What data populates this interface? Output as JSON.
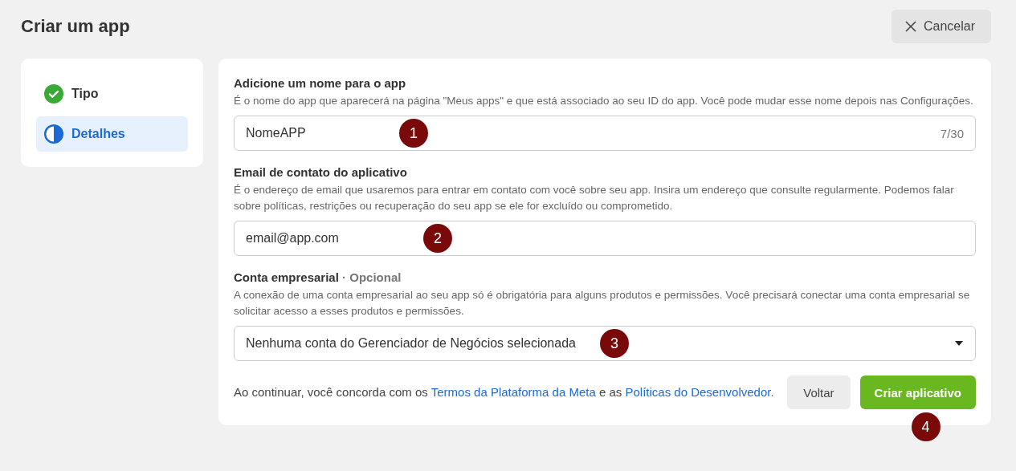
{
  "header": {
    "title": "Criar um app",
    "cancel_button": "Cancelar"
  },
  "steps": [
    {
      "label": "Tipo",
      "done": true,
      "selected": false
    },
    {
      "label": "Detalhes",
      "done": false,
      "selected": true
    }
  ],
  "fields": [
    {
      "kind": "text",
      "label": "Adicione um nome para o app",
      "help": "É o nome do app que aparecerá na página \"Meus apps\" e que está associado ao seu ID do app. Você pode mudar esse nome depois nas Configurações.",
      "value": "NomeAPP",
      "counter": "7/30",
      "annotation": "1"
    },
    {
      "kind": "text",
      "label": "Email de contato do aplicativo",
      "help": "É o endereço de email que usaremos para entrar em contato com você sobre seu app. Insira um endereço que consulte regularmente. Podemos falar sobre políticas, restrições ou recuperação do seu app se ele for excluído ou comprometido.",
      "value": "email@app.com",
      "annotation": "2"
    },
    {
      "kind": "select",
      "label": "Conta empresarial",
      "optional": "· Opcional",
      "help": "A conexão de uma conta empresarial ao seu app só é obrigatória para alguns produtos e permissões. Você precisará conectar uma conta empresarial se solicitar acesso a esses produtos e permissões.",
      "value": "Nenhuma conta do Gerenciador de Negócios selecionada",
      "annotation": "3"
    }
  ],
  "legal": [
    {
      "text": "Ao continuar, você concorda com os ",
      "link": false
    },
    {
      "text": "Termos da Plataforma da Meta",
      "link": true
    },
    {
      "text": " e as ",
      "link": false
    },
    {
      "text": "Políticas do Desenvolvedor.",
      "link": true
    }
  ],
  "footer": {
    "back_button": "Voltar",
    "create_button": "Criar aplicativo",
    "annotation": "4"
  }
}
